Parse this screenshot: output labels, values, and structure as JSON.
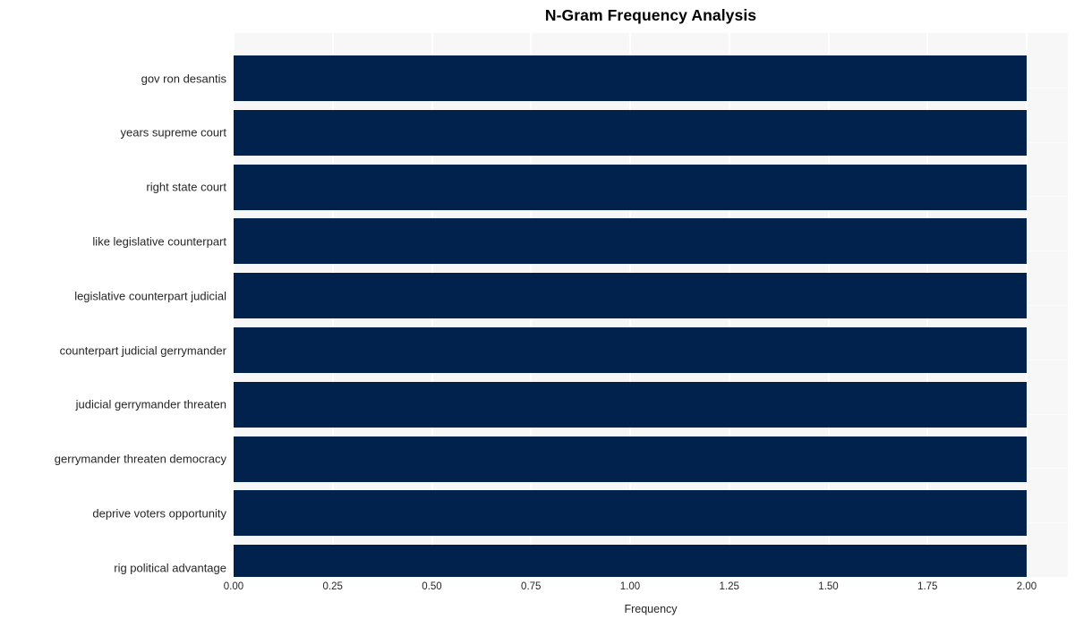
{
  "chart_data": {
    "type": "bar",
    "orientation": "horizontal",
    "title": "N-Gram Frequency Analysis",
    "xlabel": "Frequency",
    "ylabel": "",
    "categories": [
      "gov ron desantis",
      "years supreme court",
      "right state court",
      "like legislative counterpart",
      "legislative counterpart judicial",
      "counterpart judicial gerrymander",
      "judicial gerrymander threaten",
      "gerrymander threaten democracy",
      "deprive voters opportunity",
      "rig political advantage"
    ],
    "values": [
      2,
      2,
      2,
      2,
      2,
      2,
      2,
      2,
      2,
      2
    ],
    "xlim": [
      0,
      2
    ],
    "xticks": [
      "0.00",
      "0.25",
      "0.50",
      "0.75",
      "1.00",
      "1.25",
      "1.50",
      "1.75",
      "2.00"
    ],
    "xtick_values": [
      0,
      0.25,
      0.5,
      0.75,
      1,
      1.25,
      1.5,
      1.75,
      2
    ],
    "grid": true,
    "legend": "none",
    "bar_color": "#00224d",
    "plot_background": "#f7f7f7",
    "gridline_color": "#ffffff",
    "figure_background": "#ffffff"
  }
}
